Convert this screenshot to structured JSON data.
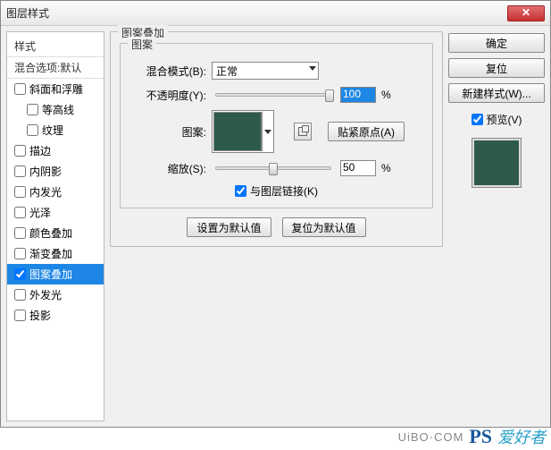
{
  "window": {
    "title": "图层样式"
  },
  "left": {
    "header": "样式",
    "sub": "混合选项:默认",
    "items": [
      {
        "label": "斜面和浮雕",
        "checked": false,
        "sub": false
      },
      {
        "label": "等高线",
        "checked": false,
        "sub": true
      },
      {
        "label": "纹理",
        "checked": false,
        "sub": true
      },
      {
        "label": "描边",
        "checked": false,
        "sub": false
      },
      {
        "label": "内阴影",
        "checked": false,
        "sub": false
      },
      {
        "label": "内发光",
        "checked": false,
        "sub": false
      },
      {
        "label": "光泽",
        "checked": false,
        "sub": false
      },
      {
        "label": "颜色叠加",
        "checked": false,
        "sub": false
      },
      {
        "label": "渐变叠加",
        "checked": false,
        "sub": false
      },
      {
        "label": "图案叠加",
        "checked": true,
        "sub": false,
        "selected": true
      },
      {
        "label": "外发光",
        "checked": false,
        "sub": false
      },
      {
        "label": "投影",
        "checked": false,
        "sub": false
      }
    ]
  },
  "center": {
    "group_title": "图案叠加",
    "inner_title": "图案",
    "blend_label": "混合模式(B):",
    "blend_value": "正常",
    "opacity_label": "不透明度(Y):",
    "opacity_value": "100",
    "percent": "%",
    "pattern_label": "图案:",
    "snap_button": "贴紧原点(A)",
    "scale_label": "缩放(S):",
    "scale_value": "50",
    "link_label": "与图层链接(K)",
    "link_checked": true,
    "default_set": "设置为默认值",
    "default_reset": "复位为默认值"
  },
  "right": {
    "ok": "确定",
    "reset": "复位",
    "new_style": "新建样式(W)...",
    "preview_label": "预览(V)",
    "preview_checked": true
  },
  "watermark": {
    "logo": "PS",
    "cn": "爱好者",
    "url": "UiBO·COM"
  }
}
